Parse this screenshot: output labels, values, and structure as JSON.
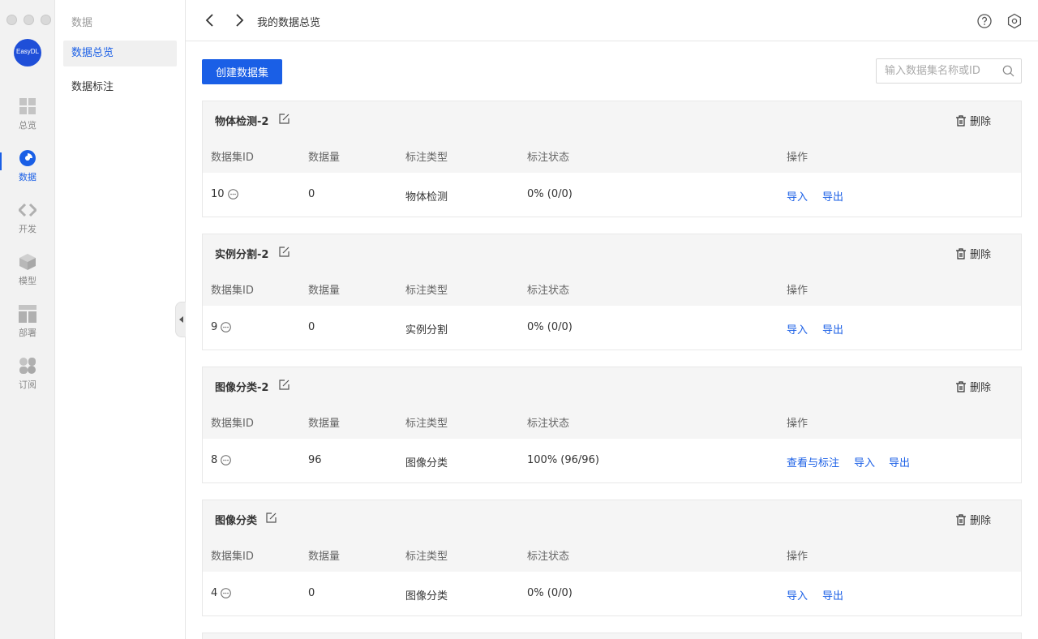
{
  "app": {
    "logo_text": "EasyDL"
  },
  "rail": [
    {
      "label": "总览",
      "icon": "dashboard-grid-icon"
    },
    {
      "label": "数据",
      "icon": "pie-chart-icon"
    },
    {
      "label": "开发",
      "icon": "code-brackets-icon"
    },
    {
      "label": "模型",
      "icon": "cube-icon"
    },
    {
      "label": "部署",
      "icon": "layout-blocks-icon"
    },
    {
      "label": "订阅",
      "icon": "clover-icon"
    }
  ],
  "sidebar": {
    "title": "数据",
    "items": [
      {
        "label": "数据总览"
      },
      {
        "label": "数据标注"
      }
    ]
  },
  "header": {
    "title": "我的数据总览"
  },
  "toolbar": {
    "create_label": "创建数据集",
    "search_placeholder": "输入数据集名称或ID"
  },
  "columns": [
    "数据集ID",
    "数据量",
    "标注类型",
    "标注状态",
    "操作"
  ],
  "delete_label": "删除",
  "datasets": [
    {
      "name": "物体检测-2",
      "id": "10",
      "count": "0",
      "type": "物体检测",
      "status": "0% (0/0)",
      "actions": [
        "导入",
        "导出"
      ]
    },
    {
      "name": "实例分割-2",
      "id": "9",
      "count": "0",
      "type": "实例分割",
      "status": "0% (0/0)",
      "actions": [
        "导入",
        "导出"
      ]
    },
    {
      "name": "图像分类-2",
      "id": "8",
      "count": "96",
      "type": "图像分类",
      "status": "100% (96/96)",
      "actions": [
        "查看与标注",
        "导入",
        "导出"
      ]
    },
    {
      "name": "图像分类",
      "id": "4",
      "count": "0",
      "type": "图像分类",
      "status": "0% (0/0)",
      "actions": [
        "导入",
        "导出"
      ]
    }
  ],
  "colors": {
    "accent": "#1a5fe6",
    "panel": "#f5f5f5"
  }
}
